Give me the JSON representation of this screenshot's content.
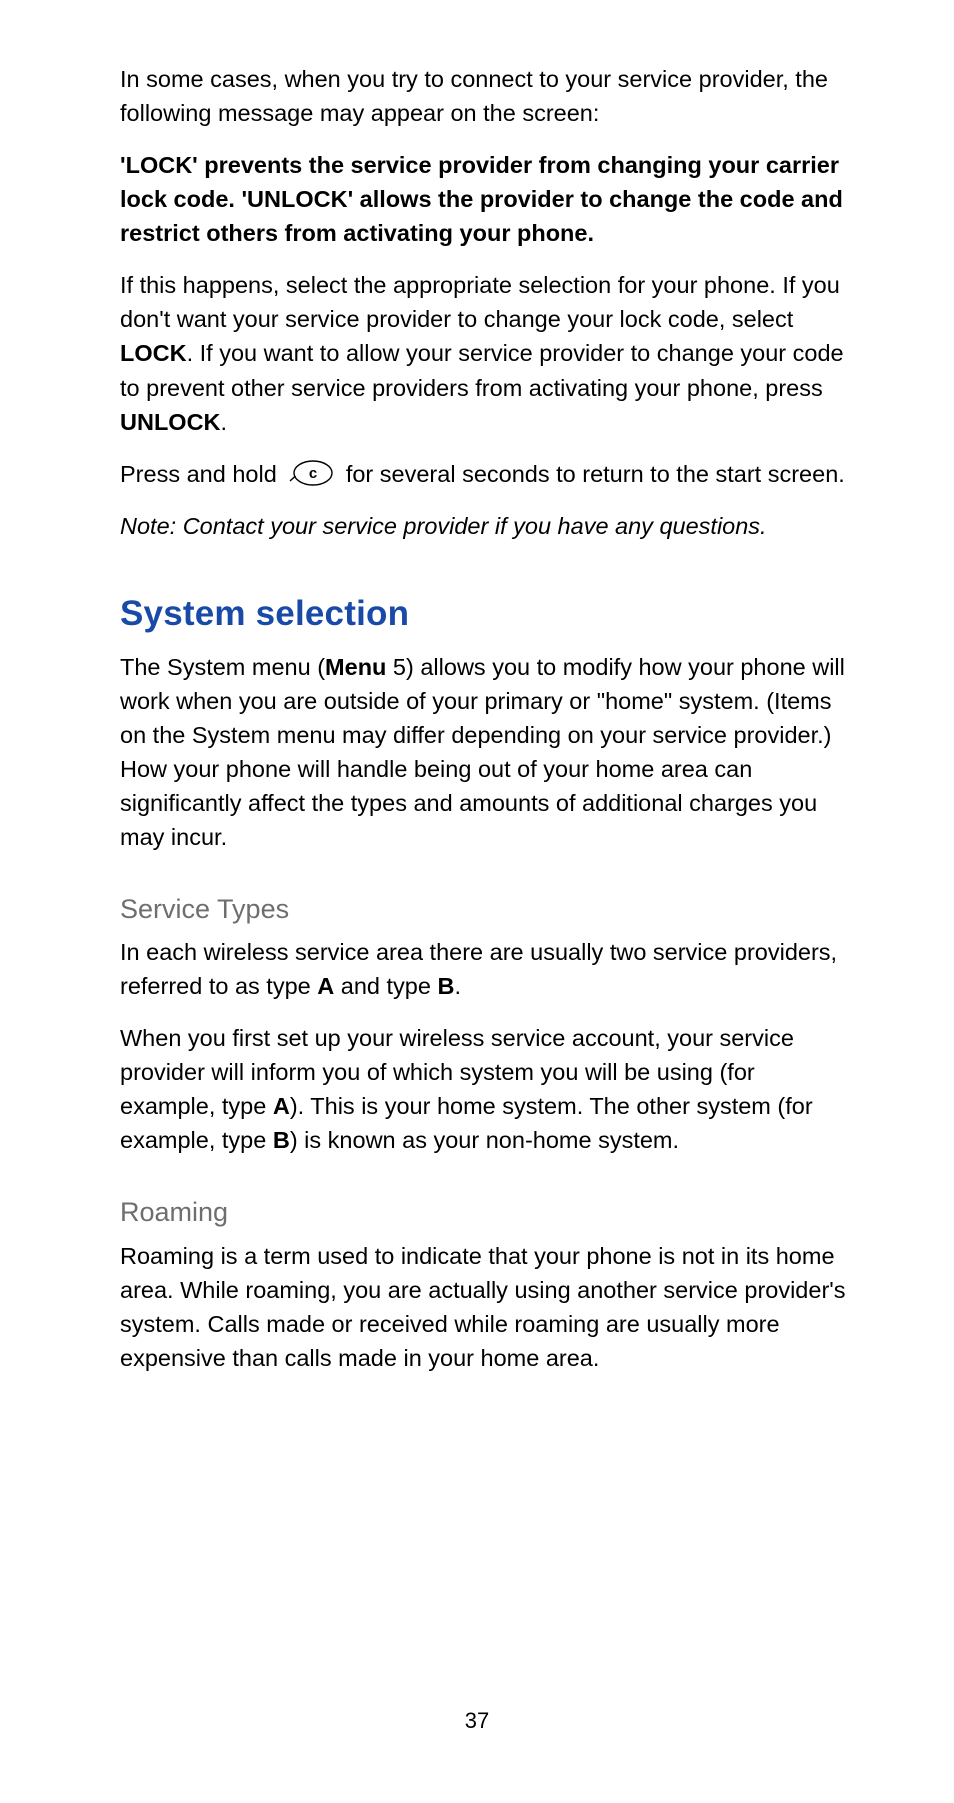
{
  "para1": "In some cases, when you try to connect to your service provider, the following message may appear on the screen:",
  "para2": "'LOCK' prevents the service provider from changing your carrier lock code. 'UNLOCK' allows the provider to change the code and restrict others from activating your phone.",
  "para3_a": "If this happens, select the appropriate selection for your phone. If you don't want your service provider to change your lock code, select ",
  "para3_b": "LOCK",
  "para3_c": ". If you want to allow your service provider to change your code to prevent other service providers from activating your phone, press ",
  "para3_d": "UNLOCK",
  "para3_e": ".",
  "para4_a": "Press and hold ",
  "para4_b": " for several seconds to return to the start screen.",
  "note": "Note:  Contact your service provider if you have any questions.",
  "heading_system_selection": "System selection",
  "para5_a": "The System menu (",
  "para5_b": "Menu",
  "para5_c": " 5) allows you to modify how your phone will work when you are outside of your primary or \"home\" system. (Items on the System menu may differ depending on your service provider.) How your phone will handle being out of your home area can significantly affect the types and amounts of additional charges you may incur.",
  "heading_service_types": "Service Types",
  "para6_a": "In each wireless service area there are usually two service providers, referred to as type ",
  "para6_b": "A",
  "para6_c": " and type ",
  "para6_d": "B",
  "para6_e": ".",
  "para7_a": "When you first set up your wireless service account, your service provider will inform you of which system you will be using (for example, type ",
  "para7_b": "A",
  "para7_c": "). This is your home system. The other system (for example, type ",
  "para7_d": "B",
  "para7_e": ") is known as your non-home system.",
  "heading_roaming": "Roaming",
  "para8": "Roaming is a term used to indicate that your phone is not in its home area. While roaming, you are actually using another service provider's system. Calls made or received while roaming are usually more expensive than calls made in your home area.",
  "page_number": "37"
}
